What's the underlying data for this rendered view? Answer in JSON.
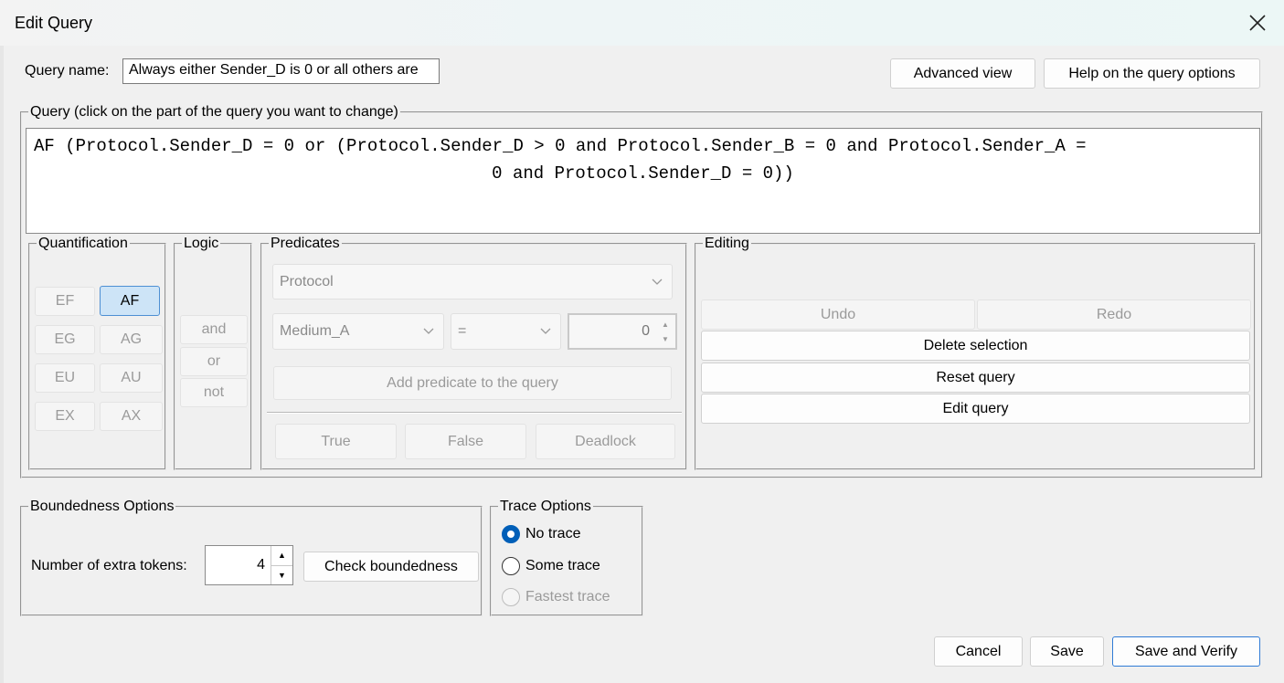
{
  "window": {
    "title": "Edit Query"
  },
  "query_name": {
    "label": "Query name:",
    "value": "Always either Sender_D is 0 or all others are"
  },
  "header_buttons": {
    "advanced": "Advanced view",
    "help": "Help on the query options"
  },
  "query_box": {
    "legend": "Query (click on the part of the query you want to change)",
    "line1": "AF (Protocol.Sender_D = 0 or (Protocol.Sender_D > 0 and Protocol.Sender_B = 0 and Protocol.Sender_A =",
    "line2": "0 and Protocol.Sender_D = 0))"
  },
  "quantification": {
    "legend": "Quantification",
    "buttons": [
      "EF",
      "AF",
      "EG",
      "AG",
      "EU",
      "AU",
      "EX",
      "AX"
    ],
    "selected": "AF"
  },
  "logic": {
    "legend": "Logic",
    "buttons": [
      "and",
      "or",
      "not"
    ]
  },
  "predicates": {
    "legend": "Predicates",
    "template": "Protocol",
    "place": "Medium_A",
    "operator": "=",
    "value": "0",
    "add_button": "Add predicate to the query",
    "constants": [
      "True",
      "False",
      "Deadlock"
    ]
  },
  "editing": {
    "legend": "Editing",
    "undo": "Undo",
    "redo": "Redo",
    "delete": "Delete selection",
    "reset": "Reset query",
    "edit": "Edit query"
  },
  "boundedness": {
    "legend": "Boundedness Options",
    "tokens_label": "Number of extra tokens:",
    "tokens_value": "4",
    "check_button": "Check boundedness"
  },
  "trace": {
    "legend": "Trace Options",
    "options": [
      "No trace",
      "Some trace",
      "Fastest trace"
    ],
    "selected": "No trace"
  },
  "footer": {
    "cancel": "Cancel",
    "save": "Save",
    "save_verify": "Save and Verify"
  },
  "colors": {
    "accent": "#005fb8",
    "selected_button": "#cde4f7"
  }
}
